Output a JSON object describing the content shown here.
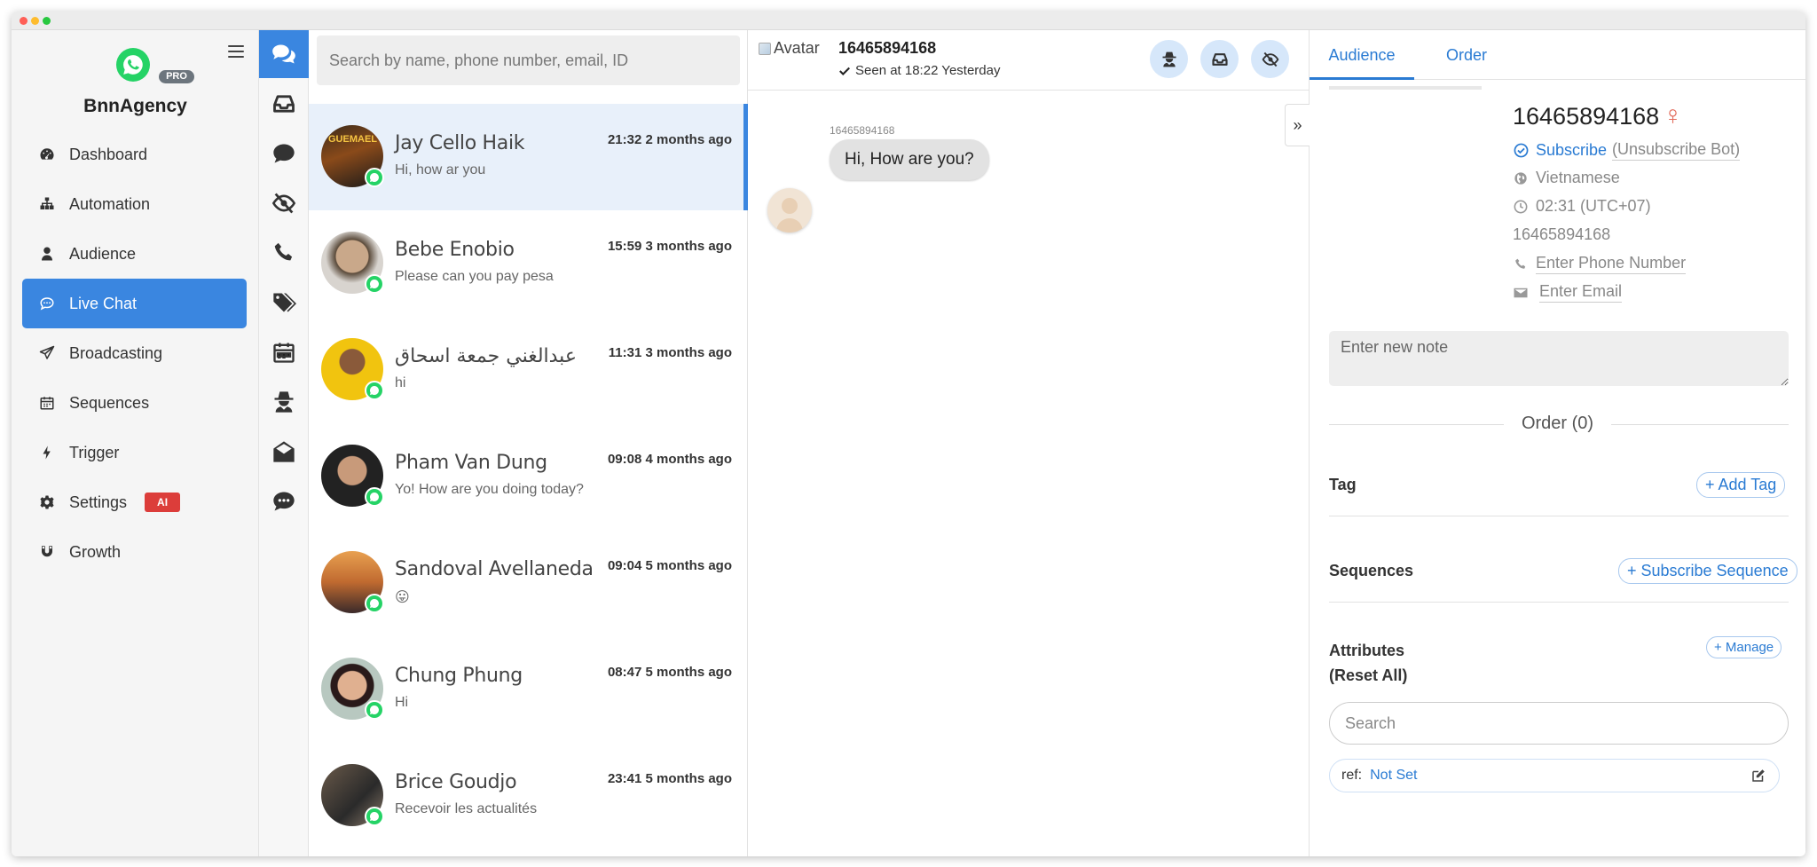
{
  "brand": {
    "name": "BnnAgency",
    "pro_label": "PRO"
  },
  "sidebar": {
    "items": [
      {
        "label": "Dashboard",
        "icon": "dashboard-icon"
      },
      {
        "label": "Automation",
        "icon": "sitemap-icon"
      },
      {
        "label": "Audience",
        "icon": "user-icon"
      },
      {
        "label": "Live Chat",
        "icon": "chat-bubble-icon",
        "active": true
      },
      {
        "label": "Broadcasting",
        "icon": "paper-plane-icon"
      },
      {
        "label": "Sequences",
        "icon": "calendar-icon"
      },
      {
        "label": "Trigger",
        "icon": "bolt-icon"
      },
      {
        "label": "Settings",
        "icon": "gear-icon",
        "badge": "AI"
      },
      {
        "label": "Growth",
        "icon": "magnet-icon"
      }
    ]
  },
  "icon_column": [
    "comments-icon",
    "inbox-icon",
    "comment-icon",
    "eye-slash-icon",
    "phone-icon",
    "tags-icon",
    "calendar-icon",
    "user-secret-icon",
    "envelope-open-icon",
    "commenting-icon"
  ],
  "conversations": {
    "search_placeholder": "Search by name, phone number, email, ID",
    "items": [
      {
        "name": "Jay Cello Haik",
        "preview": "Hi, how ar you",
        "time": "21:32 2 months ago",
        "active": true
      },
      {
        "name": "Bebe Enobio",
        "preview": "Please can you pay pesa",
        "time": "15:59 3 months ago"
      },
      {
        "name": "عبدالغني جمعة اسحاق",
        "preview": "hi",
        "time": "11:31 3 months ago"
      },
      {
        "name": "Pham Van Dung",
        "preview": "Yo! How are you doing today?",
        "time": "09:08 4 months ago"
      },
      {
        "name": "Sandoval Avellaneda",
        "preview": "😛",
        "time": "09:04 5 months ago"
      },
      {
        "name": "Chung Phung",
        "preview": "Hi",
        "time": "08:47 5 months ago"
      },
      {
        "name": "Brice Goudjo",
        "preview": "Recevoir les actualités",
        "time": "23:41 5 months ago"
      }
    ]
  },
  "chat": {
    "avatar_alt": "Avatar",
    "title": "16465894168",
    "seen": "Seen at 18:22 Yesterday",
    "message_sender": "16465894168",
    "message_text": "Hi, How are you?"
  },
  "panel": {
    "tabs": [
      "Audience",
      "Order"
    ],
    "profile_name": "16465894168",
    "gender_symbol": "♀",
    "subscribe_label": "Subscribe",
    "unsubscribe_label": "(Unsubscribe Bot)",
    "language": "Vietnamese",
    "timezone": "02:31 (UTC+07)",
    "phone_id": "16465894168",
    "phone_placeholder": "Enter Phone Number",
    "email_placeholder": "Enter Email",
    "note_placeholder": "Enter new note",
    "order_label": "Order (0)",
    "tag_title": "Tag",
    "add_tag_label": "+ Add Tag",
    "sequences_title": "Sequences",
    "subscribe_sequence_label": "+ Subscribe Sequence",
    "attributes_title": "Attributes",
    "reset_all_label": "(Reset All)",
    "manage_label": "+ Manage",
    "attr_search_placeholder": "Search",
    "attribute": {
      "key": "ref:",
      "value": "Not Set"
    }
  },
  "colors": {
    "accent": "#3a86e0",
    "whatsapp": "#25d366",
    "ai_badge": "#dc3d3a"
  }
}
